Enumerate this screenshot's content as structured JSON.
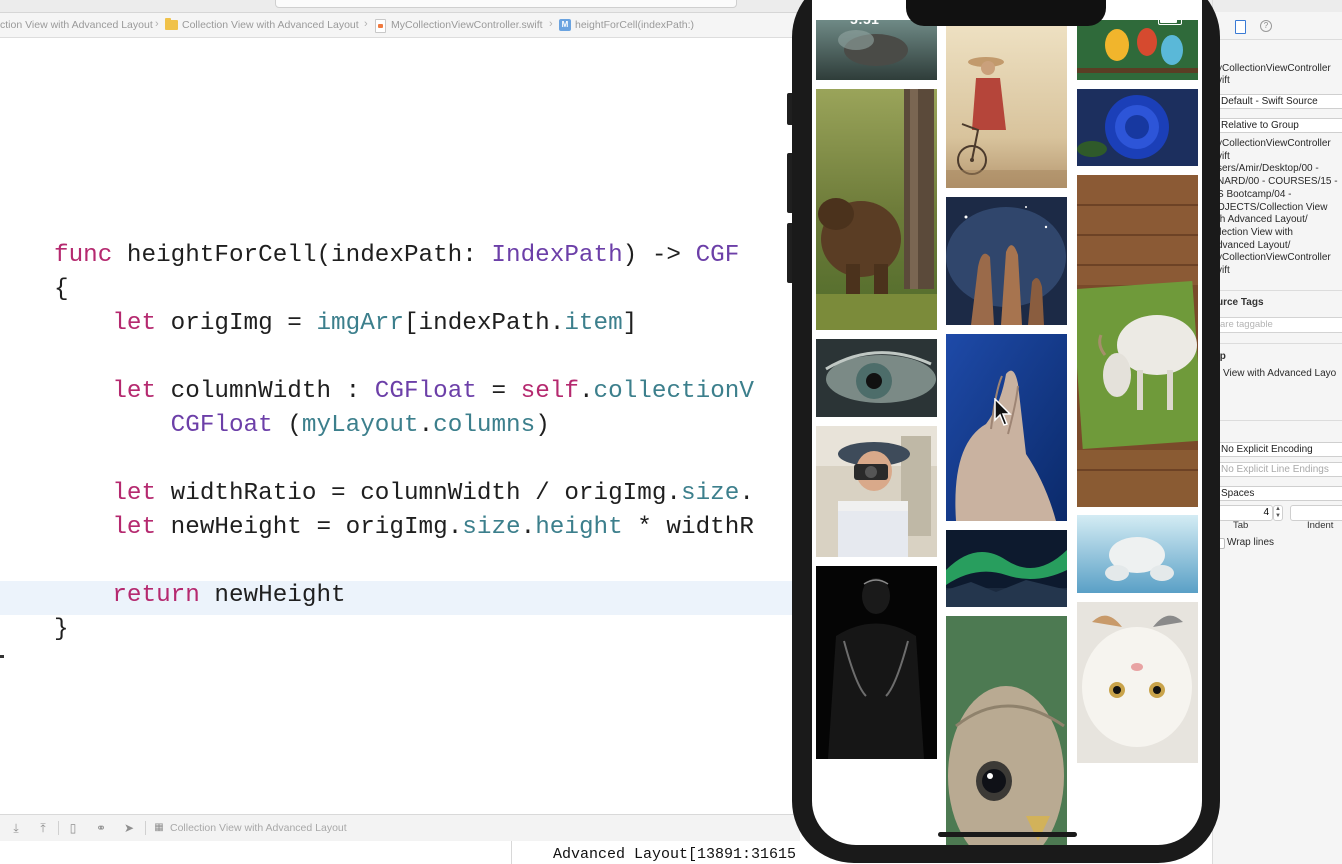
{
  "breadcrumbs": [
    {
      "label": "ction View with Advanced Layout"
    },
    {
      "label": "Collection View with Advanced Layout",
      "icon": "folder-icon"
    },
    {
      "label": "MyCollectionViewController.swift",
      "icon": "swift-file-icon"
    },
    {
      "label": "heightForCell(indexPath:)",
      "icon": "method-icon",
      "icon_letter": "M"
    }
  ],
  "editor": {
    "lines": [
      [
        {
          "t": "func",
          "c": "kw"
        },
        {
          "t": " heightForCell(indexPath: "
        },
        {
          "t": "IndexPath",
          "c": "type"
        },
        {
          "t": ") -> "
        },
        {
          "t": "CGF",
          "c": "type"
        }
      ],
      [
        {
          "t": "{"
        }
      ],
      [
        {
          "t": "    "
        },
        {
          "t": "let",
          "c": "kw"
        },
        {
          "t": " origImg = "
        },
        {
          "t": "imgArr",
          "c": "prop"
        },
        {
          "t": "[indexPath."
        },
        {
          "t": "item",
          "c": "prop"
        },
        {
          "t": "]"
        }
      ],
      [
        {
          "t": ""
        }
      ],
      [
        {
          "t": "    "
        },
        {
          "t": "let",
          "c": "kw"
        },
        {
          "t": " columnWidth : "
        },
        {
          "t": "CGFloat",
          "c": "type"
        },
        {
          "t": " = "
        },
        {
          "t": "self",
          "c": "kw"
        },
        {
          "t": "."
        },
        {
          "t": "collectionV",
          "c": "prop"
        }
      ],
      [
        {
          "t": "        "
        },
        {
          "t": "CGFloat",
          "c": "type"
        },
        {
          "t": " ("
        },
        {
          "t": "myLayout",
          "c": "prop"
        },
        {
          "t": "."
        },
        {
          "t": "columns",
          "c": "prop"
        },
        {
          "t": ")"
        }
      ],
      [
        {
          "t": ""
        }
      ],
      [
        {
          "t": "    "
        },
        {
          "t": "let",
          "c": "kw"
        },
        {
          "t": " widthRatio = columnWidth / origImg."
        },
        {
          "t": "size",
          "c": "prop"
        },
        {
          "t": "."
        }
      ],
      [
        {
          "t": "    "
        },
        {
          "t": "let",
          "c": "kw"
        },
        {
          "t": " newHeight = origImg."
        },
        {
          "t": "size",
          "c": "prop"
        },
        {
          "t": "."
        },
        {
          "t": "height",
          "c": "prop"
        },
        {
          "t": " * widthR"
        }
      ],
      [
        {
          "t": ""
        }
      ],
      [
        {
          "t": "    "
        },
        {
          "t": "return",
          "c": "kw"
        },
        {
          "t": " newHeight"
        }
      ],
      [
        {
          "t": "}"
        }
      ]
    ],
    "highlighted_line": 10
  },
  "debug_bar": {
    "target_label": "Collection View with Advanced Layout"
  },
  "console": {
    "text": "Advanced Layout[13891:31615"
  },
  "simulator": {
    "time": "5:51",
    "cells": [
      {
        "name": "cell-aquarium",
        "desc": "underwater"
      },
      {
        "name": "cell-bear",
        "desc": "bear"
      },
      {
        "name": "cell-eye",
        "desc": "eye"
      },
      {
        "name": "cell-photographer",
        "desc": "photographer"
      },
      {
        "name": "cell-silhouette",
        "desc": "silhouette"
      },
      {
        "name": "cell-woman-bicycle",
        "desc": "woman with bicycle"
      },
      {
        "name": "cell-nebula",
        "desc": "nebula"
      },
      {
        "name": "cell-hands",
        "desc": "hands"
      },
      {
        "name": "cell-aurora",
        "desc": "aurora"
      },
      {
        "name": "cell-owl",
        "desc": "owl"
      },
      {
        "name": "cell-parrots",
        "desc": "parrots"
      },
      {
        "name": "cell-blue-rose",
        "desc": "blue rose"
      },
      {
        "name": "cell-goat",
        "desc": "goat"
      },
      {
        "name": "cell-polar-bear",
        "desc": "polar bear"
      },
      {
        "name": "cell-cat",
        "desc": "cat"
      }
    ]
  },
  "inspector": {
    "file_name_lines": [
      "yCollectionViewController",
      "vift"
    ],
    "file_type": "Default - Swift Source",
    "location": "Relative to Group",
    "full_path_lines": [
      "yCollectionViewController",
      "vift",
      "sers/Amir/Desktop/00 -",
      "NARD/00 - COURSES/15 -",
      "S Bootcamp/04 -",
      "OJECTS/Collection View",
      "th Advanced Layout/",
      "llection View with",
      "dvanced Layout/",
      "yCollectionViewController",
      "vift"
    ],
    "source_tags_header": "urce Tags",
    "source_tags_placeholder": "are taggable",
    "target_header": "ip",
    "target_label": "View with Advanced Layo",
    "text_encoding": "No Explicit Encoding",
    "line_endings": "No Explicit Line Endings",
    "indent_using": "Spaces",
    "tab_width": "4",
    "tab_label": "Tab",
    "indent_label": "Indent",
    "wrap_lines_label": "Wrap lines"
  }
}
